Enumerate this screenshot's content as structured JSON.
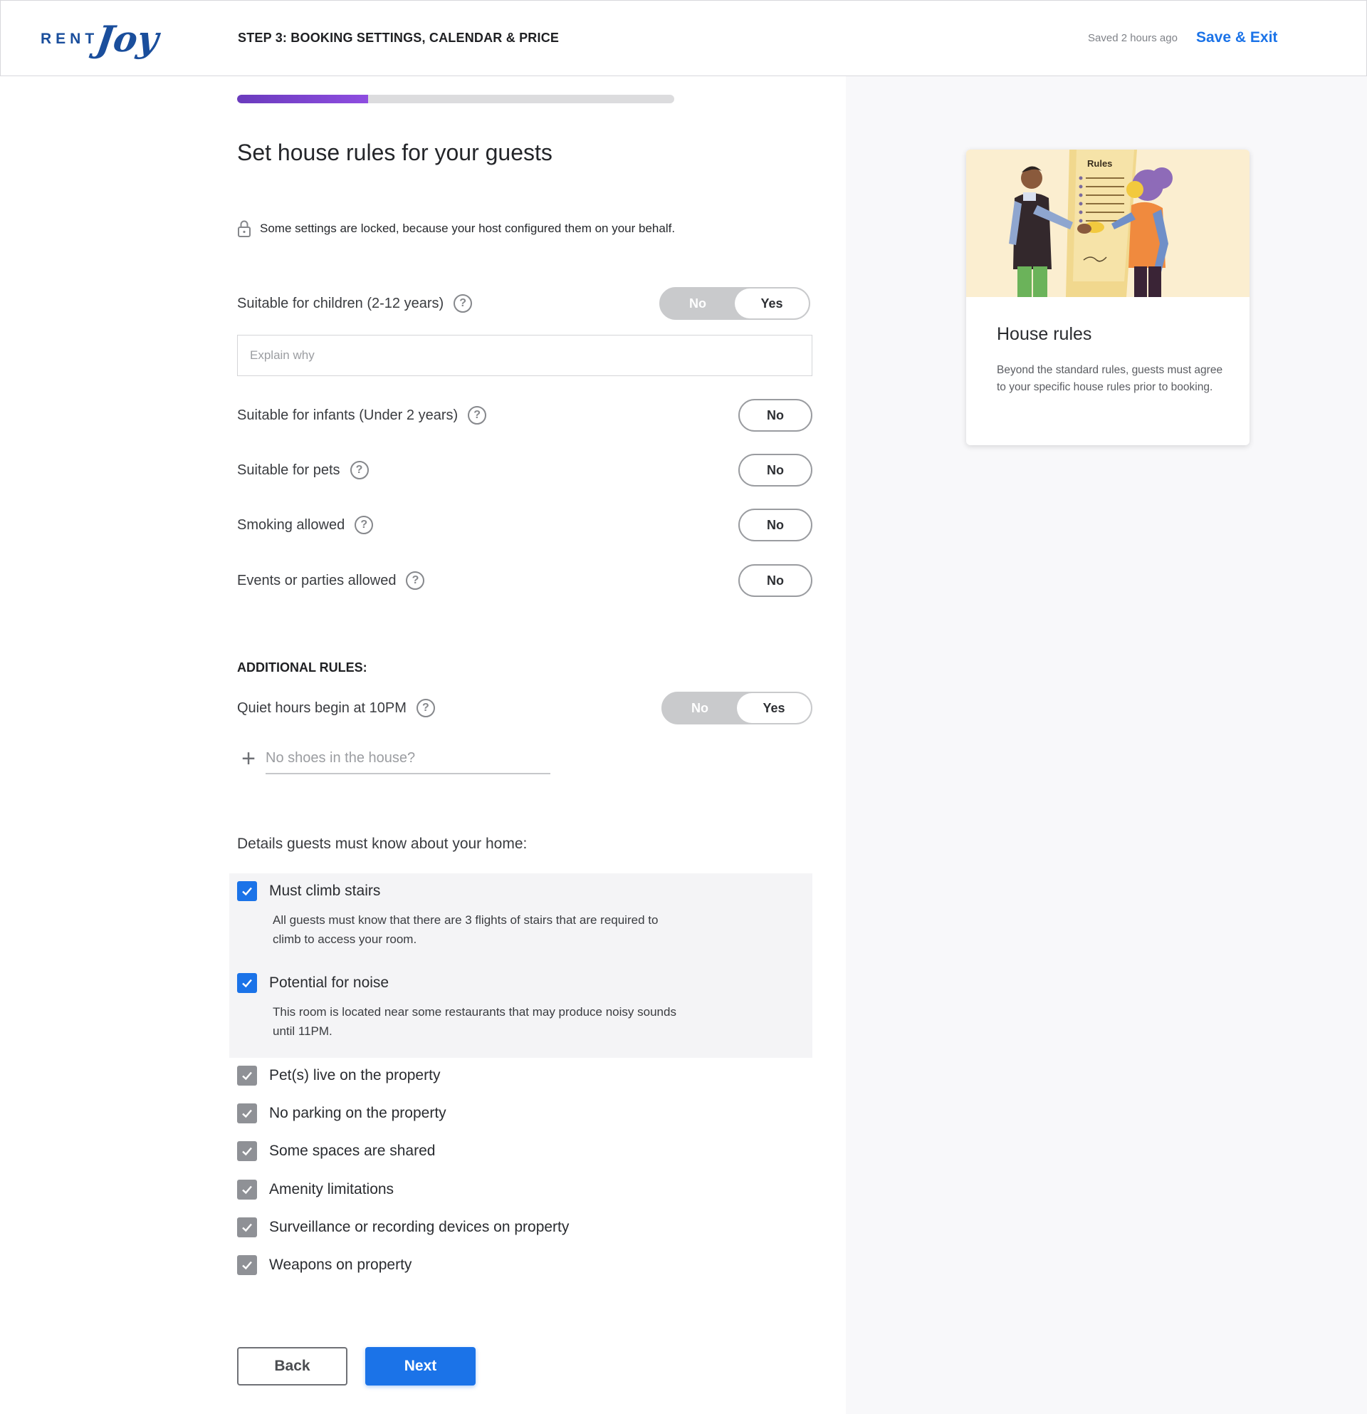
{
  "brand": {
    "rent": "RENT",
    "joy": "Joy"
  },
  "header": {
    "step": "STEP 3: BOOKING SETTINGS, CALENDAR & PRICE",
    "saved": "Saved 2 hours ago",
    "save_exit": "Save & Exit"
  },
  "progress": {
    "fraction": 0.3
  },
  "page": {
    "title": "Set house rules for your guests",
    "locked_note": "Some settings are locked, because your host configured them on your behalf."
  },
  "rules": {
    "children": {
      "label": "Suitable for children (2-12 years)",
      "no": "No",
      "yes": "Yes",
      "selected": "Yes"
    },
    "explain_placeholder": "Explain why",
    "infants": {
      "label": "Suitable for infants (Under 2 years)",
      "value": "No"
    },
    "pets": {
      "label": "Suitable for pets",
      "value": "No"
    },
    "smoking": {
      "label": "Smoking allowed",
      "value": "No"
    },
    "events": {
      "label": "Events or parties allowed",
      "value": "No"
    }
  },
  "additional": {
    "heading": "ADDITIONAL RULES:",
    "quiet_hours": {
      "label": "Quiet hours begin at 10PM",
      "no": "No",
      "yes": "Yes",
      "selected": "Yes"
    },
    "add_placeholder": "No shoes in the house?"
  },
  "details": {
    "heading": "Details guests must know about your home:",
    "items": [
      {
        "label": "Must climb stairs",
        "checked": true,
        "desc": "All guests must know that there are 3 flights of stairs that are required to climb to access your room."
      },
      {
        "label": "Potential for noise",
        "checked": true,
        "desc": "This room is located near some restaurants that may produce noisy sounds until 11PM."
      },
      {
        "label": "Pet(s) live on the property",
        "checked": true,
        "locked": true
      },
      {
        "label": "No parking on the property",
        "checked": true,
        "locked": true
      },
      {
        "label": "Some spaces are shared",
        "checked": true,
        "locked": true
      },
      {
        "label": "Amenity limitations",
        "checked": true,
        "locked": true
      },
      {
        "label": "Surveillance or recording devices on property",
        "checked": true,
        "locked": true
      },
      {
        "label": "Weapons on property",
        "checked": true,
        "locked": true
      }
    ]
  },
  "buttons": {
    "back": "Back",
    "next": "Next"
  },
  "side_card": {
    "illustration_label": "Rules",
    "title": "House rules",
    "body": "Beyond the standard rules, guests must agree to your specific house rules prior to booking."
  },
  "colors": {
    "accent": "#1b73e8",
    "progress": "#7a44d4",
    "locked_grey": "#8f9196"
  },
  "icons": [
    "lock-icon",
    "help-icon",
    "plus-icon",
    "check-icon"
  ]
}
